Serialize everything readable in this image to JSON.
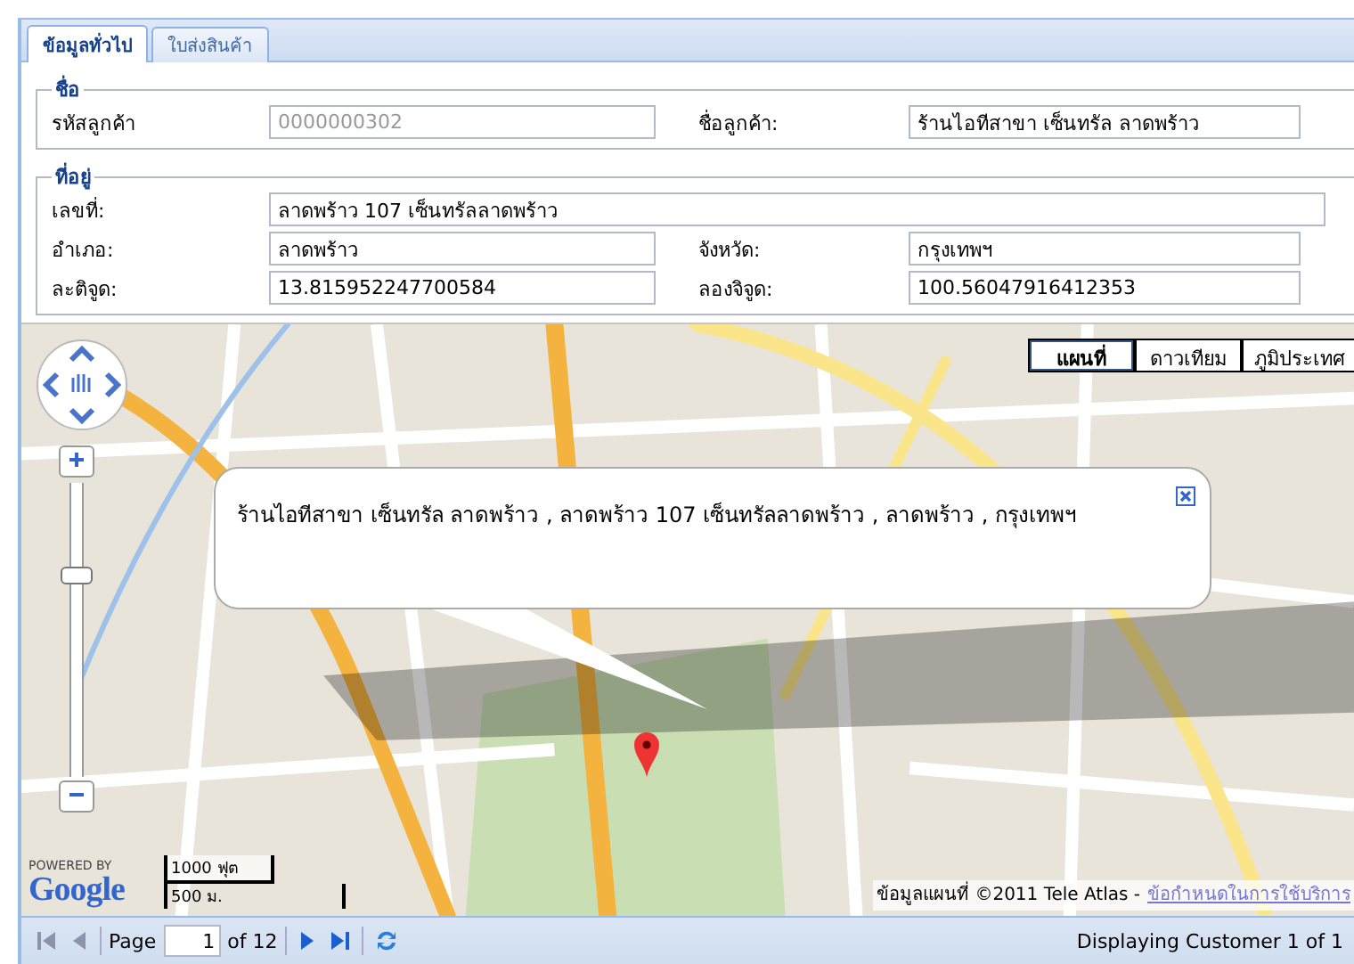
{
  "tabs": [
    {
      "label": "ข้อมูลทั่วไป",
      "selected": true
    },
    {
      "label": "ใบส่งสินค้า",
      "selected": false
    }
  ],
  "sections": [
    {
      "legend": "ชื่อ",
      "rows": [
        [
          {
            "label": "รหัสลูกค้า",
            "value": "0000000302",
            "disabled": true
          },
          {
            "label": "ชื่อลูกค้า:",
            "value": "ร้านไอทีสาขา เซ็นทรัล ลาดพร้าว",
            "disabled": false
          }
        ]
      ]
    },
    {
      "legend": "ที่อยู่",
      "rows": [
        [
          {
            "label": "เลขที่:",
            "value": "ลาดพร้าว 107 เซ็นทรัลลาดพร้าว",
            "disabled": false
          }
        ],
        [
          {
            "label": "อำเภอ:",
            "value": "ลาดพร้าว",
            "disabled": false
          },
          {
            "label": "จังหวัด:",
            "value": "กรุงเทพฯ",
            "disabled": false
          }
        ],
        [
          {
            "label": "ละติจูด:",
            "value": "13.815952247700584",
            "disabled": false
          },
          {
            "label": "ลองจิจูด:",
            "value": "100.56047916412353",
            "disabled": false
          }
        ]
      ]
    }
  ],
  "map": {
    "type_buttons": [
      {
        "label": "แผนที่",
        "selected": true
      },
      {
        "label": "ดาวเทียม",
        "selected": false
      },
      {
        "label": "ภูมิประเทศ",
        "selected": false
      }
    ],
    "zoom": {
      "level": 0.7
    },
    "info_window": {
      "text": "ร้านไอทีสาขา เซ็นทรัล ลาดพร้าว , ลาดพร้าว 107 เซ็นทรัลลาดพร้าว , ลาดพร้าว , กรุงเทพฯ"
    },
    "powered_by": "POWERED BY",
    "logo": "Google",
    "scale": [
      "1000 ฟุต",
      "500 ม."
    ],
    "attribution": {
      "text": "ข้อมูลแผนที่ ©2011 Tele Atlas -",
      "link": "ข้อกำหนดในการใช้บริการ"
    }
  },
  "pager": {
    "buttons": [
      {
        "kind": "first",
        "disabled": true
      },
      {
        "kind": "prev",
        "disabled": true
      },
      {
        "kind": "next",
        "disabled": false
      },
      {
        "kind": "last",
        "disabled": false
      },
      {
        "kind": "refresh",
        "disabled": false
      }
    ],
    "page_label": "Page",
    "page_value": "1",
    "of_label": "of 12",
    "status": "Displaying Customer 1 of 1"
  }
}
